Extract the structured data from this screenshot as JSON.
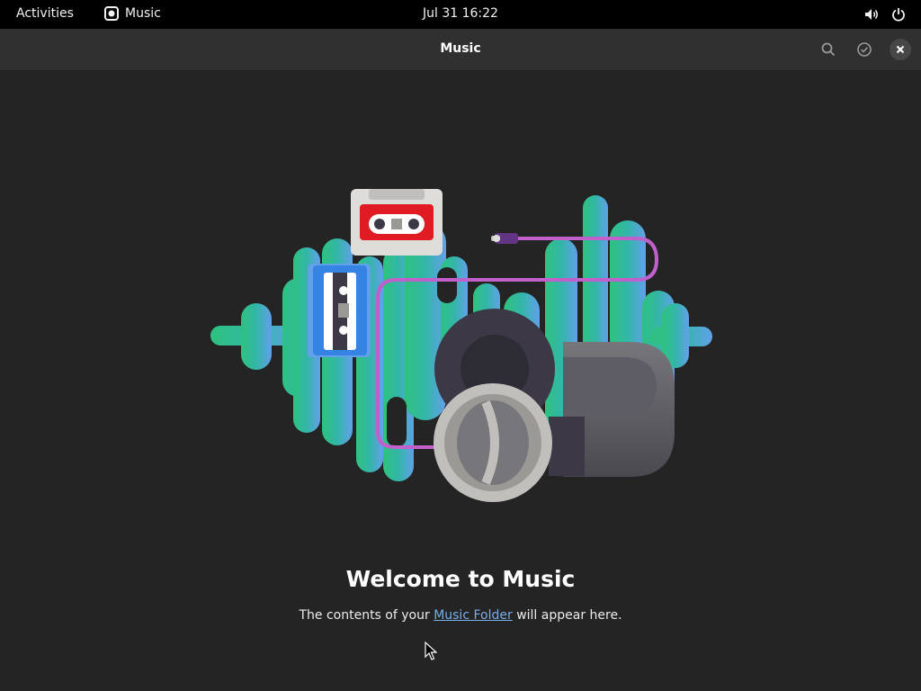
{
  "topbar": {
    "activities": "Activities",
    "app_name": "Music",
    "clock": "Jul 31  16:22",
    "icons": [
      "speaker-icon",
      "power-icon"
    ]
  },
  "headerbar": {
    "title": "Music",
    "icons": [
      "search-icon",
      "select-check-icon",
      "close-icon"
    ]
  },
  "empty_state": {
    "heading": "Welcome to Music",
    "text_before": "The contents of your ",
    "link": "Music Folder",
    "text_after": " will appear here."
  },
  "colors": {
    "background": "#242424",
    "topbar": "#000000",
    "headerbar": "#303030",
    "link": "#78aeed"
  }
}
